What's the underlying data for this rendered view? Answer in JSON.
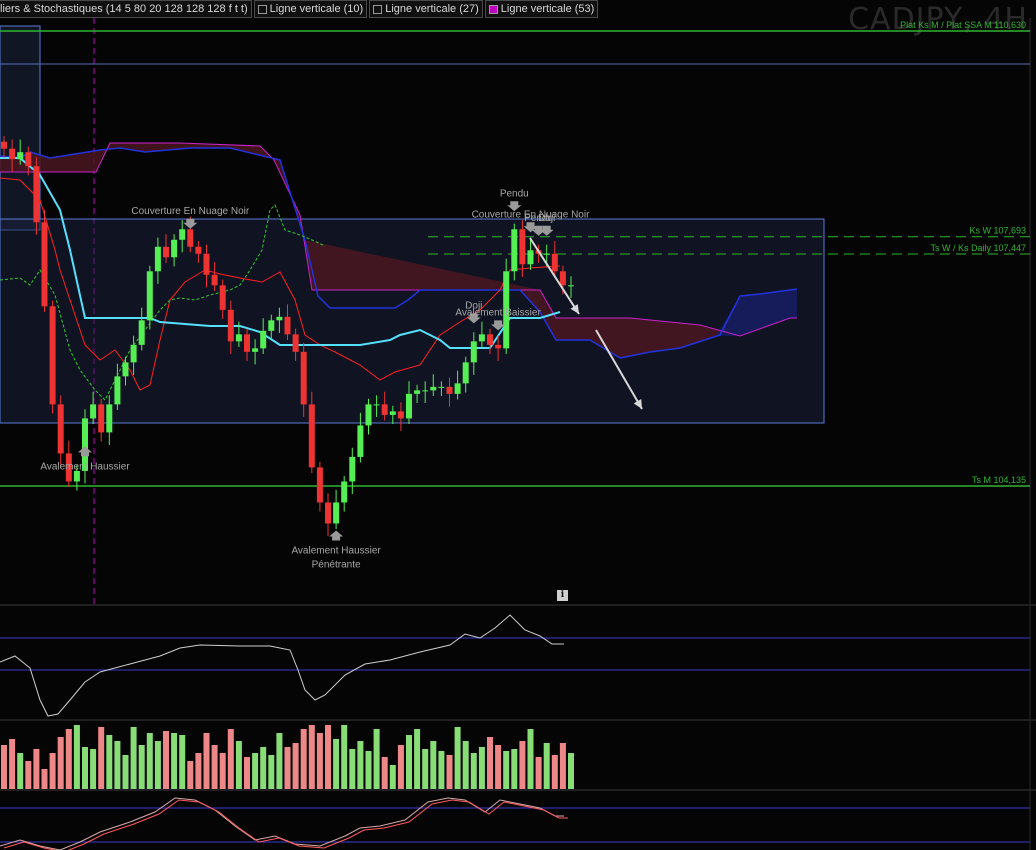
{
  "toolbar": {
    "indicator_label": "liers & Stochastiques (14 5 80 20 128 128 128 f t t)",
    "vline_10": "Ligne verticale (10)",
    "vline_27": "Ligne verticale (27)",
    "vline_53": "Ligne verticale (53)",
    "vline_53_color": "#c000c0"
  },
  "watermark": "CADJPY, 4H",
  "info_icon": "i",
  "colors": {
    "bull": "#55ee55",
    "bear": "#ee3333",
    "kijun": "#55e0ff",
    "tenkan": "#ff2222",
    "chikou": "#33cc33",
    "kumo_bear_fill": "#4a1620",
    "kumo_bull_fill": "#121c60",
    "level_line": "#2fb52f",
    "zone_border": "#5a7ad8",
    "vol_up": "#88dd77",
    "vol_down": "#ee8888"
  },
  "chart_data": {
    "type": "candlestick",
    "price_levels": [
      {
        "label": "Plat Ks M / Plat SSA M 110,630",
        "price": 110.63,
        "style": "solid"
      },
      {
        "label": "Ks W 107,693",
        "price": 107.693,
        "style": "dashed"
      },
      {
        "label": "Ts W / Ks Daily 107,447",
        "price": 107.447,
        "style": "dashed"
      },
      {
        "label": "Ts M 104,135",
        "price": 104.135,
        "style": "solid"
      }
    ],
    "patterns": [
      {
        "label": "Couverture En Nuage Noir",
        "bar": 23,
        "pos": "above"
      },
      {
        "label": "Avalement Haussier",
        "bar": 10,
        "pos": "below"
      },
      {
        "label": "Avalement Haussier",
        "label2": "Pénétrante",
        "bar": 41,
        "pos": "below"
      },
      {
        "label": "Doji",
        "bar": 58,
        "pos": "above"
      },
      {
        "label": "Avalement Baissier",
        "bar": 61,
        "pos": "above"
      },
      {
        "label": "Couverture En Nuage Noir",
        "bar": 65,
        "pos": "above"
      },
      {
        "label": "Pendu",
        "bar": 63,
        "pos": "above"
      },
      {
        "label": "Pendu",
        "bar": 66,
        "pos": "above"
      },
      {
        "label": "Doji",
        "bar": 67,
        "pos": "above"
      }
    ],
    "candles_close": [
      108.95,
      108.8,
      108.9,
      108.7,
      107.9,
      106.7,
      105.3,
      104.6,
      104.2,
      104.35,
      105.1,
      105.3,
      104.9,
      105.3,
      105.7,
      105.9,
      106.15,
      106.5,
      107.2,
      107.55,
      107.4,
      107.65,
      107.8,
      107.55,
      107.45,
      107.15,
      107.0,
      106.65,
      106.2,
      106.3,
      106.05,
      106.1,
      106.35,
      106.5,
      106.55,
      106.3,
      106.05,
      105.3,
      104.4,
      103.9,
      103.6,
      103.9,
      104.2,
      104.55,
      105.0,
      105.3,
      105.3,
      105.15,
      105.2,
      105.1,
      105.45,
      105.5,
      105.5,
      105.55,
      105.55,
      105.45,
      105.6,
      105.9,
      106.2,
      106.3,
      106.15,
      106.1,
      107.2,
      107.8,
      107.3,
      107.5,
      107.45,
      107.45,
      107.2,
      107.0,
      107.0
    ],
    "volume": [
      22,
      25,
      18,
      14,
      20,
      10,
      18,
      26,
      30,
      32,
      21,
      20,
      31,
      27,
      24,
      17,
      31,
      22,
      28,
      24,
      29,
      28,
      27,
      14,
      18,
      28,
      22,
      18,
      30,
      24,
      16,
      18,
      21,
      17,
      28,
      21,
      23,
      30,
      32,
      28,
      32,
      25,
      32,
      20,
      24,
      19,
      30,
      16,
      12,
      22,
      27,
      30,
      20,
      24,
      19,
      17,
      31,
      24,
      18,
      21,
      26,
      22,
      19,
      20,
      24,
      30,
      16,
      23,
      17,
      23,
      18
    ]
  }
}
